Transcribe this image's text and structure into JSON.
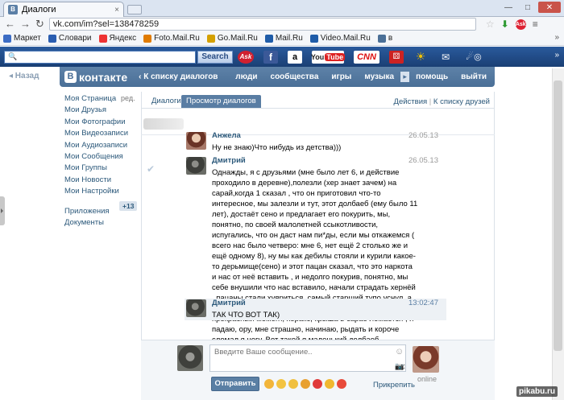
{
  "browser": {
    "tab_title": "Диалоги",
    "tab_close": "×",
    "url": "vk.com/im?sel=138478259",
    "window_controls": {
      "minimize": "—",
      "maximize": "□",
      "close": "✕"
    },
    "nav_icons": {
      "back": "←",
      "forward": "→",
      "reload": "↻",
      "star": "☆",
      "download": "⬇",
      "wrench": "≡"
    }
  },
  "bookmarks": [
    {
      "label": "Маркет",
      "icon": "market-icon",
      "color": "#3c6cc4"
    },
    {
      "label": "Словари",
      "icon": "dictionary-icon",
      "color": "#2a5db0"
    },
    {
      "label": "Яндекс",
      "icon": "yandex-icon",
      "color": "#e33"
    },
    {
      "label": "Foto.Mail.Ru",
      "icon": "mail-icon",
      "color": "#e07b00"
    },
    {
      "label": "Go.Mail.Ru",
      "icon": "go-icon",
      "color": "#d4a000"
    },
    {
      "label": "Mail.Ru",
      "icon": "mail-icon",
      "color": "#1f5ca8"
    },
    {
      "label": "Video.Mail.Ru",
      "icon": "video-icon",
      "color": "#1f5ca8"
    },
    {
      "label": "в",
      "icon": "vk-icon",
      "color": "#4a6f97"
    }
  ],
  "bookmarks_more": "»",
  "asktoolbar": {
    "search_button": "Search",
    "search_value": "",
    "ask_logo": "Ask",
    "youtube_you": "You",
    "youtube_tube": "Tube",
    "cnn": "CNN",
    "facebook": "f",
    "amazon": "a",
    "more": "»"
  },
  "vk": {
    "logo_letter": "В",
    "logo_text": "контакте",
    "back_to_dialogs": "‹ К списку диалогов",
    "menu": [
      "люди",
      "сообщества",
      "игры",
      "музыка",
      "помощь",
      "выйти"
    ],
    "menu_arrow": "▸",
    "back_link": "◂  Назад",
    "left_menu": [
      "Моя Страница",
      "Мои Друзья",
      "Мои Фотографии",
      "Мои Видеозаписи",
      "Мои Аудиозаписи",
      "Мои Сообщения",
      "Мои Группы",
      "Мои Новости",
      "Мои Настройки"
    ],
    "edit_label": "ред.",
    "apps": "Приложения",
    "apps_count": "+13",
    "docs": "Документы",
    "tabs": {
      "dialogs": "Диалоги",
      "view": "Просмотр диалогов"
    },
    "tabs_right": {
      "actions": "Действия",
      "sep": "|",
      "friends": "К списку друзей"
    },
    "messages": [
      {
        "name": "Анжела",
        "date": "26.05.13",
        "text": "Ну не знаю)Что нибудь из детства)))"
      },
      {
        "name": "Дмитрий",
        "date": "26.05.13",
        "text": "Однажды, я с друзьями (мне было лет 6, и действие проходило в деревне),полезли (хер знает зачем) на сарай,когда 1 сказал , что он приготовил что-то интересное, мы залезли и тут, этот долбаеб (ему было 11 лет), достаёт сено и предлагает его покурить, мы, понятно, по своей малолетней ссыкотливости, испугались, что он даст нам пи*ды, если мы откажемся ( всего нас было четверо: мне 6, нет ещё 2 столько же и ещё одному 8), ну мы как дебилы стояли и курили какое-то дерьмище(сено) и этот пацан сказал, что это наркота и нас от неё вставить , и недолго покурив, понятно, мы себе внушили что нас вставило, начали страдать хернёй , пацаны стали хуяриться, самый старший тупо уснул, а я, не знаю зачем стал прыгать по сараю, и вдруг, в 1 прекрасный момент, херакс, крыша в сарае ломается , я падаю, ору, мне страшно, начинаю, рыдать и короче сломал я ногу. Вот такой я маленький долбаеб."
      },
      {
        "name": "Дмитрий",
        "date": "13:02:47",
        "text": "ТАК ЧТО ВОТ ТАК)"
      }
    ],
    "read_check": "✔",
    "composer": {
      "placeholder": "Введите Ваше сообщение..",
      "send": "Отправить",
      "attach": "Прикрепить",
      "online": "online",
      "smile_icon": "☺",
      "camera_icon": "📷"
    },
    "emoji_colors": [
      "#f2b53a",
      "#f3c341",
      "#f0c040",
      "#e8a030",
      "#e03a3a",
      "#f0b830",
      "#e84a3a"
    ]
  },
  "watermark": "pikabu.ru"
}
